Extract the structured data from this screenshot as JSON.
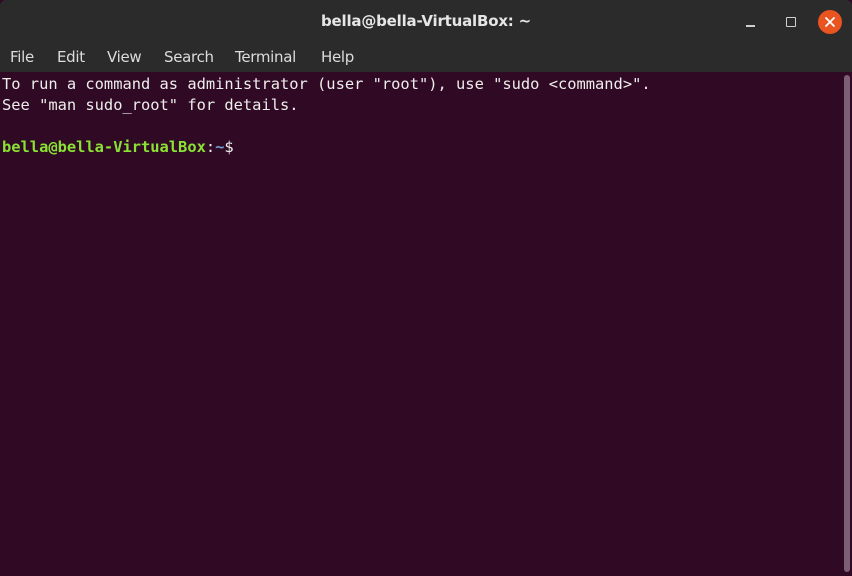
{
  "window": {
    "title": "bella@bella-VirtualBox: ~",
    "controls": [
      "minimize",
      "maximize",
      "close"
    ],
    "close_color": "#e95420"
  },
  "menu": {
    "items": [
      {
        "label": "File"
      },
      {
        "label": "Edit"
      },
      {
        "label": "View"
      },
      {
        "label": "Search"
      },
      {
        "label": "Terminal"
      },
      {
        "label": "Help"
      }
    ]
  },
  "terminal": {
    "background": "#300a24",
    "lines": [
      "To run a command as administrator (user \"root\"), use \"sudo <command>\".",
      "See \"man sudo_root\" for details.",
      ""
    ],
    "prompt": {
      "user_host": "bella@bella-VirtualBox",
      "separator": ":",
      "path": "~",
      "symbol": "$",
      "user_color": "#8ae234",
      "path_color": "#729fcf"
    }
  }
}
